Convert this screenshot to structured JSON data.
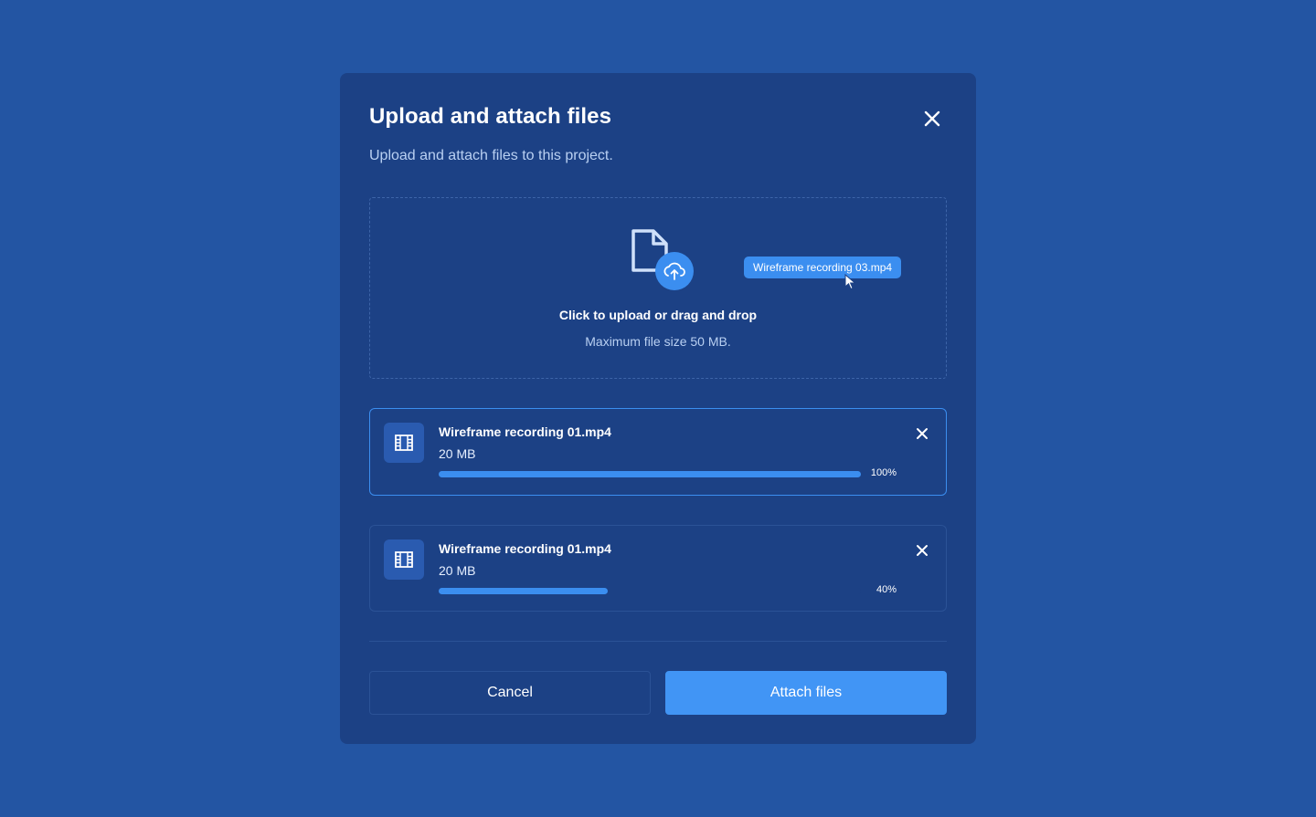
{
  "modal": {
    "title": "Upload and attach files",
    "subtitle": "Upload and attach files to this project.",
    "close_icon": "close-icon"
  },
  "dropzone": {
    "title": "Click to upload or drag and drop",
    "hint": "Maximum file size 50 MB.",
    "icon": "file-upload-icon",
    "dragging_file": "Wireframe recording 03.mp4"
  },
  "files": [
    {
      "name": "Wireframe recording 01.mp4",
      "size": "20 MB",
      "progress": 1.0,
      "progress_label": "100%",
      "icon": "film-icon",
      "state": "complete"
    },
    {
      "name": "Wireframe recording 01.mp4",
      "size": "20 MB",
      "progress": 0.4,
      "progress_label": "40%",
      "icon": "film-icon",
      "state": "uploading"
    }
  ],
  "actions": {
    "cancel_label": "Cancel",
    "attach_label": "Attach files"
  },
  "colors": {
    "background": "#2355a3",
    "modal": "#1c4185",
    "accent": "#3b8ef0",
    "primary_button": "#4195f5",
    "muted_text": "#b9d0f2"
  }
}
